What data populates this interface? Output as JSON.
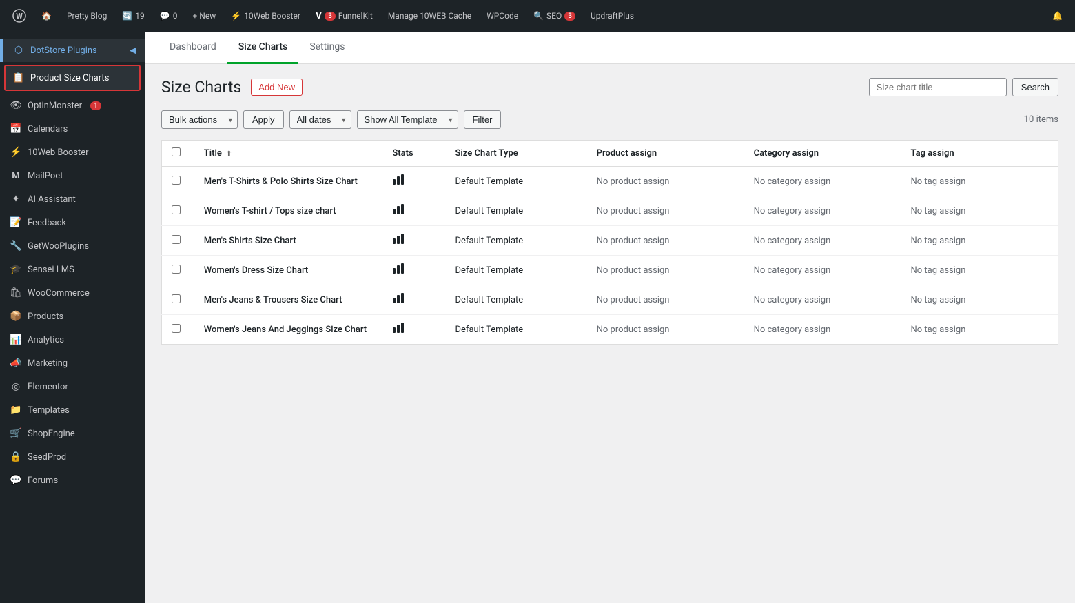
{
  "admin_bar": {
    "wp_icon": "W",
    "site_name": "Pretty Blog",
    "updates_count": "19",
    "comments_count": "0",
    "new_label": "+ New",
    "booster_label": "10Web Booster",
    "funnel_kit_label": "FunnelKit",
    "funnel_kit_badge": "3",
    "cache_label": "Manage 10WEB Cache",
    "wpcode_label": "WPCode",
    "seo_label": "SEO",
    "seo_badge": "3",
    "updraft_label": "UpdraftPlus"
  },
  "sidebar": {
    "plugin_name": "DotStore Plugins",
    "active_item": "Product Size Charts",
    "items": [
      {
        "id": "product-size-charts",
        "label": "Product Size Charts",
        "icon": "📋"
      },
      {
        "id": "optinmonster",
        "label": "OptinMonster",
        "icon": "👁",
        "badge": "1"
      },
      {
        "id": "calendars",
        "label": "Calendars",
        "icon": "📅"
      },
      {
        "id": "10web-booster",
        "label": "10Web Booster",
        "icon": "⚡"
      },
      {
        "id": "mailpoet",
        "label": "MailPoet",
        "icon": "M"
      },
      {
        "id": "ai-assistant",
        "label": "AI Assistant",
        "icon": "✦"
      },
      {
        "id": "feedback",
        "label": "Feedback",
        "icon": "📝"
      },
      {
        "id": "getwoo-plugins",
        "label": "GetWooPlugins",
        "icon": "🔧"
      },
      {
        "id": "sensei-lms",
        "label": "Sensei LMS",
        "icon": "🎓"
      },
      {
        "id": "woocommerce",
        "label": "WooCommerce",
        "icon": "🛍"
      },
      {
        "id": "products",
        "label": "Products",
        "icon": "📦"
      },
      {
        "id": "analytics",
        "label": "Analytics",
        "icon": "📊"
      },
      {
        "id": "marketing",
        "label": "Marketing",
        "icon": "📣"
      },
      {
        "id": "elementor",
        "label": "Elementor",
        "icon": "◎"
      },
      {
        "id": "templates",
        "label": "Templates",
        "icon": "📁"
      },
      {
        "id": "shopengine",
        "label": "ShopEngine",
        "icon": "🛒"
      },
      {
        "id": "seedprod",
        "label": "SeedProd",
        "icon": "🔒"
      },
      {
        "id": "forums",
        "label": "Forums",
        "icon": "💬"
      }
    ]
  },
  "tabs": [
    {
      "id": "dashboard",
      "label": "Dashboard",
      "active": false
    },
    {
      "id": "size-charts",
      "label": "Size Charts",
      "active": true
    },
    {
      "id": "settings",
      "label": "Settings",
      "active": false
    }
  ],
  "page": {
    "title": "Size Charts",
    "add_new_label": "Add New",
    "search_placeholder": "Size chart title",
    "search_button": "Search",
    "items_count": "10 items"
  },
  "filters": {
    "bulk_actions_label": "Bulk actions",
    "apply_label": "Apply",
    "all_dates_label": "All dates",
    "show_all_template_label": "Show All Template",
    "filter_label": "Filter"
  },
  "table": {
    "columns": [
      {
        "id": "title",
        "label": "Title",
        "sortable": true
      },
      {
        "id": "stats",
        "label": "Stats"
      },
      {
        "id": "type",
        "label": "Size Chart Type"
      },
      {
        "id": "product_assign",
        "label": "Product assign"
      },
      {
        "id": "category_assign",
        "label": "Category assign"
      },
      {
        "id": "tag_assign",
        "label": "Tag assign"
      }
    ],
    "rows": [
      {
        "id": 1,
        "title": "Men's T-Shirts & Polo Shirts Size Chart",
        "stats": "bar",
        "type": "Default Template",
        "product_assign": "No product assign",
        "category_assign": "No category assign",
        "tag_assign": "No tag assign"
      },
      {
        "id": 2,
        "title": "Women's T-shirt / Tops size chart",
        "stats": "bar",
        "type": "Default Template",
        "product_assign": "No product assign",
        "category_assign": "No category assign",
        "tag_assign": "No tag assign"
      },
      {
        "id": 3,
        "title": "Men's Shirts Size Chart",
        "stats": "bar",
        "type": "Default Template",
        "product_assign": "No product assign",
        "category_assign": "No category assign",
        "tag_assign": "No tag assign"
      },
      {
        "id": 4,
        "title": "Women's Dress Size Chart",
        "stats": "bar",
        "type": "Default Template",
        "product_assign": "No product assign",
        "category_assign": "No category assign",
        "tag_assign": "No tag assign"
      },
      {
        "id": 5,
        "title": "Men's Jeans & Trousers Size Chart",
        "stats": "bar",
        "type": "Default Template",
        "product_assign": "No product assign",
        "category_assign": "No category assign",
        "tag_assign": "No tag assign"
      },
      {
        "id": 6,
        "title": "Women's Jeans And Jeggings Size Chart",
        "stats": "bar",
        "type": "Default Template",
        "product_assign": "No product assign",
        "category_assign": "No category assign",
        "tag_assign": "No tag assign"
      }
    ]
  }
}
